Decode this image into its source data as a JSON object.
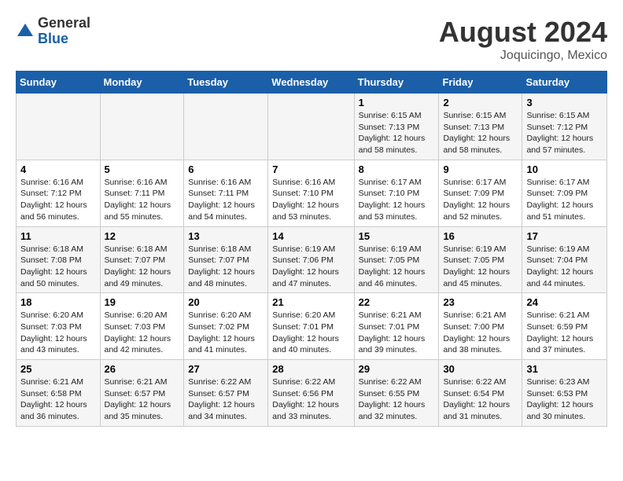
{
  "logo": {
    "general": "General",
    "blue": "Blue"
  },
  "title": "August 2024",
  "subtitle": "Joquicingo, Mexico",
  "days_of_week": [
    "Sunday",
    "Monday",
    "Tuesday",
    "Wednesday",
    "Thursday",
    "Friday",
    "Saturday"
  ],
  "weeks": [
    [
      {
        "day": "",
        "info": ""
      },
      {
        "day": "",
        "info": ""
      },
      {
        "day": "",
        "info": ""
      },
      {
        "day": "",
        "info": ""
      },
      {
        "day": "1",
        "info": "Sunrise: 6:15 AM\nSunset: 7:13 PM\nDaylight: 12 hours\nand 58 minutes."
      },
      {
        "day": "2",
        "info": "Sunrise: 6:15 AM\nSunset: 7:13 PM\nDaylight: 12 hours\nand 58 minutes."
      },
      {
        "day": "3",
        "info": "Sunrise: 6:15 AM\nSunset: 7:12 PM\nDaylight: 12 hours\nand 57 minutes."
      }
    ],
    [
      {
        "day": "4",
        "info": "Sunrise: 6:16 AM\nSunset: 7:12 PM\nDaylight: 12 hours\nand 56 minutes."
      },
      {
        "day": "5",
        "info": "Sunrise: 6:16 AM\nSunset: 7:11 PM\nDaylight: 12 hours\nand 55 minutes."
      },
      {
        "day": "6",
        "info": "Sunrise: 6:16 AM\nSunset: 7:11 PM\nDaylight: 12 hours\nand 54 minutes."
      },
      {
        "day": "7",
        "info": "Sunrise: 6:16 AM\nSunset: 7:10 PM\nDaylight: 12 hours\nand 53 minutes."
      },
      {
        "day": "8",
        "info": "Sunrise: 6:17 AM\nSunset: 7:10 PM\nDaylight: 12 hours\nand 53 minutes."
      },
      {
        "day": "9",
        "info": "Sunrise: 6:17 AM\nSunset: 7:09 PM\nDaylight: 12 hours\nand 52 minutes."
      },
      {
        "day": "10",
        "info": "Sunrise: 6:17 AM\nSunset: 7:09 PM\nDaylight: 12 hours\nand 51 minutes."
      }
    ],
    [
      {
        "day": "11",
        "info": "Sunrise: 6:18 AM\nSunset: 7:08 PM\nDaylight: 12 hours\nand 50 minutes."
      },
      {
        "day": "12",
        "info": "Sunrise: 6:18 AM\nSunset: 7:07 PM\nDaylight: 12 hours\nand 49 minutes."
      },
      {
        "day": "13",
        "info": "Sunrise: 6:18 AM\nSunset: 7:07 PM\nDaylight: 12 hours\nand 48 minutes."
      },
      {
        "day": "14",
        "info": "Sunrise: 6:19 AM\nSunset: 7:06 PM\nDaylight: 12 hours\nand 47 minutes."
      },
      {
        "day": "15",
        "info": "Sunrise: 6:19 AM\nSunset: 7:05 PM\nDaylight: 12 hours\nand 46 minutes."
      },
      {
        "day": "16",
        "info": "Sunrise: 6:19 AM\nSunset: 7:05 PM\nDaylight: 12 hours\nand 45 minutes."
      },
      {
        "day": "17",
        "info": "Sunrise: 6:19 AM\nSunset: 7:04 PM\nDaylight: 12 hours\nand 44 minutes."
      }
    ],
    [
      {
        "day": "18",
        "info": "Sunrise: 6:20 AM\nSunset: 7:03 PM\nDaylight: 12 hours\nand 43 minutes."
      },
      {
        "day": "19",
        "info": "Sunrise: 6:20 AM\nSunset: 7:03 PM\nDaylight: 12 hours\nand 42 minutes."
      },
      {
        "day": "20",
        "info": "Sunrise: 6:20 AM\nSunset: 7:02 PM\nDaylight: 12 hours\nand 41 minutes."
      },
      {
        "day": "21",
        "info": "Sunrise: 6:20 AM\nSunset: 7:01 PM\nDaylight: 12 hours\nand 40 minutes."
      },
      {
        "day": "22",
        "info": "Sunrise: 6:21 AM\nSunset: 7:01 PM\nDaylight: 12 hours\nand 39 minutes."
      },
      {
        "day": "23",
        "info": "Sunrise: 6:21 AM\nSunset: 7:00 PM\nDaylight: 12 hours\nand 38 minutes."
      },
      {
        "day": "24",
        "info": "Sunrise: 6:21 AM\nSunset: 6:59 PM\nDaylight: 12 hours\nand 37 minutes."
      }
    ],
    [
      {
        "day": "25",
        "info": "Sunrise: 6:21 AM\nSunset: 6:58 PM\nDaylight: 12 hours\nand 36 minutes."
      },
      {
        "day": "26",
        "info": "Sunrise: 6:21 AM\nSunset: 6:57 PM\nDaylight: 12 hours\nand 35 minutes."
      },
      {
        "day": "27",
        "info": "Sunrise: 6:22 AM\nSunset: 6:57 PM\nDaylight: 12 hours\nand 34 minutes."
      },
      {
        "day": "28",
        "info": "Sunrise: 6:22 AM\nSunset: 6:56 PM\nDaylight: 12 hours\nand 33 minutes."
      },
      {
        "day": "29",
        "info": "Sunrise: 6:22 AM\nSunset: 6:55 PM\nDaylight: 12 hours\nand 32 minutes."
      },
      {
        "day": "30",
        "info": "Sunrise: 6:22 AM\nSunset: 6:54 PM\nDaylight: 12 hours\nand 31 minutes."
      },
      {
        "day": "31",
        "info": "Sunrise: 6:23 AM\nSunset: 6:53 PM\nDaylight: 12 hours\nand 30 minutes."
      }
    ]
  ]
}
